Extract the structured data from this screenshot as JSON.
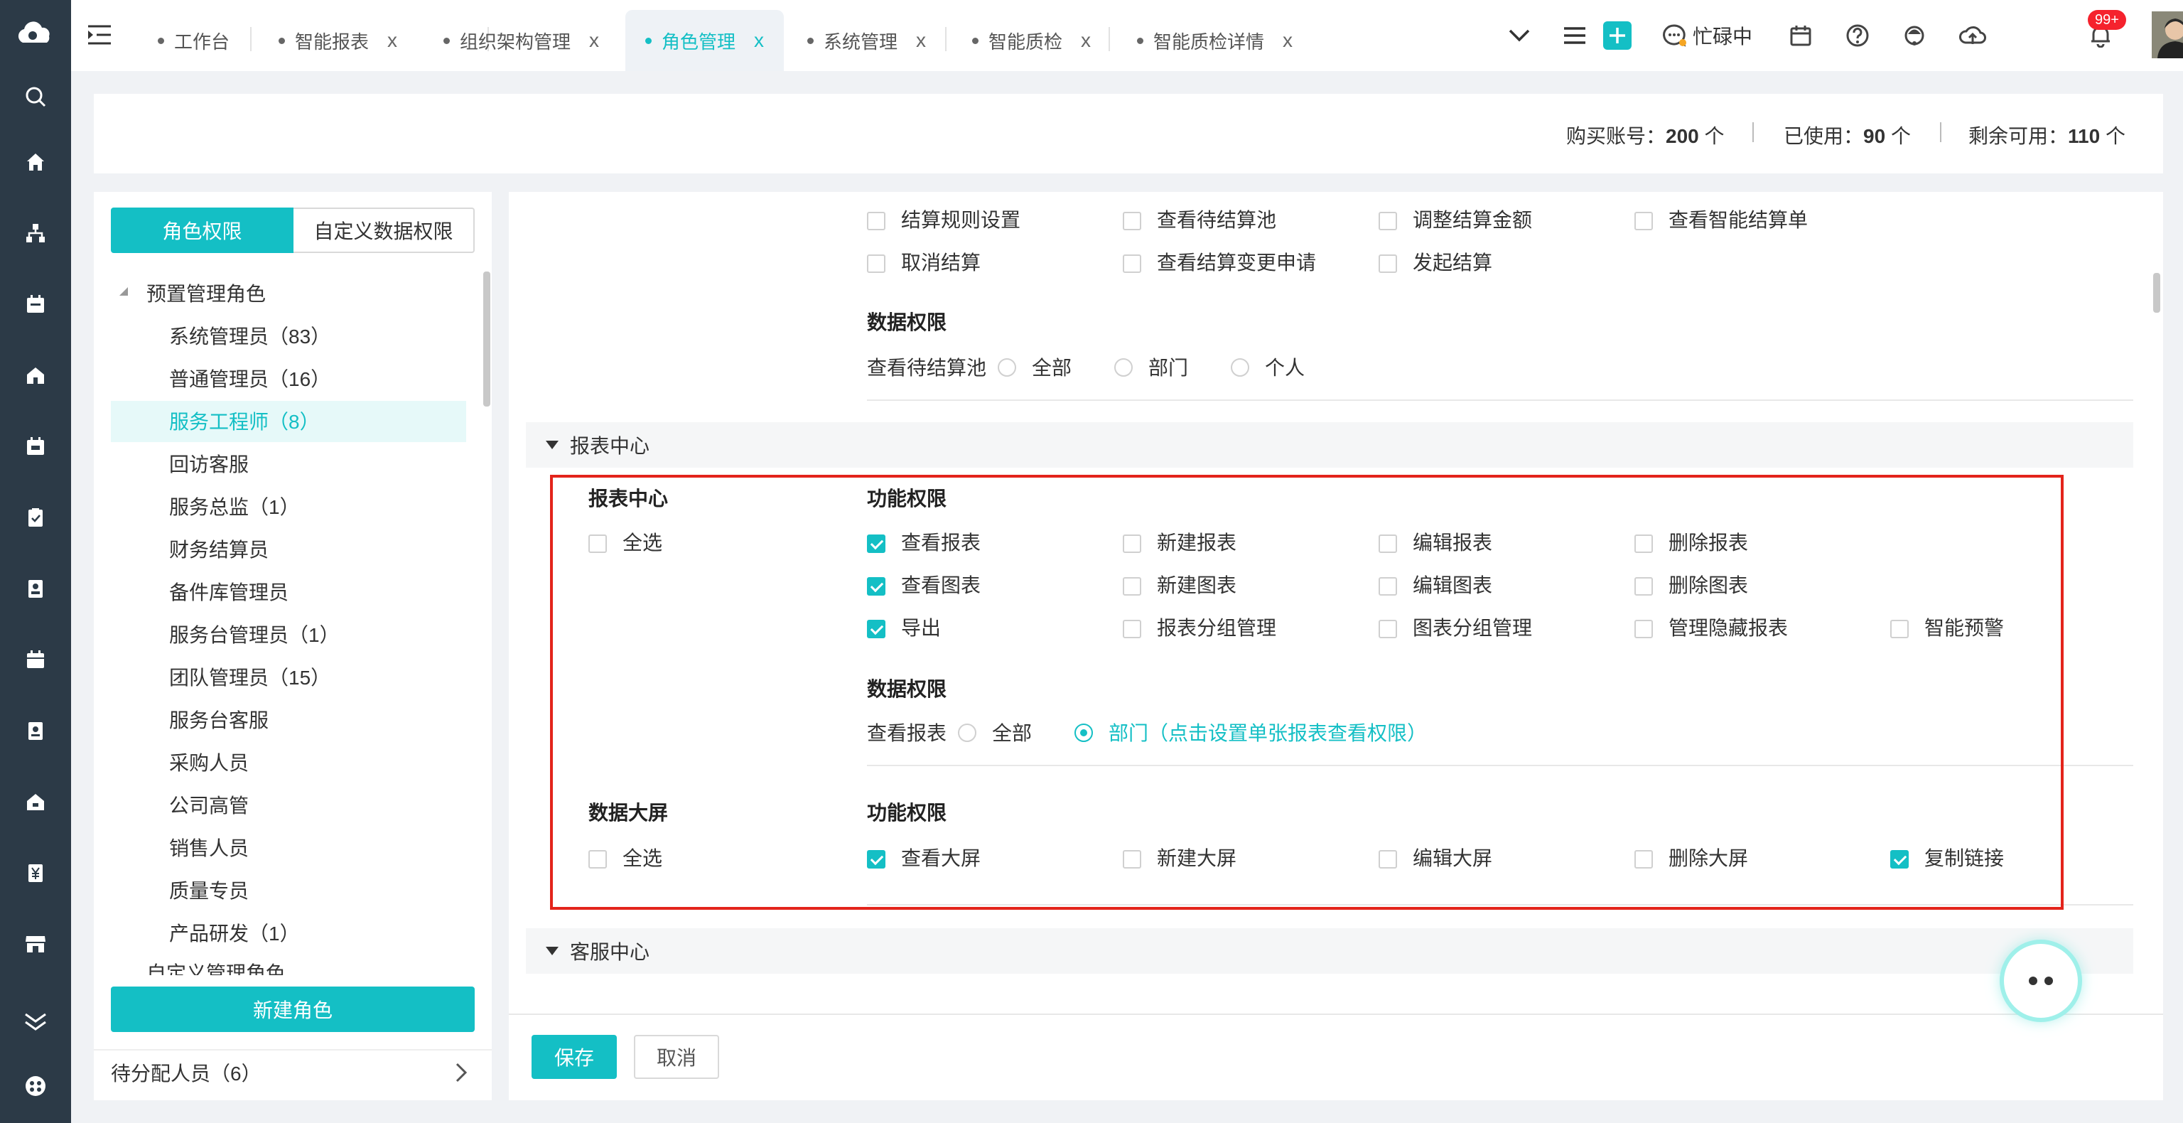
{
  "sidebar": {
    "icons": [
      "logo-icon",
      "search-icon",
      "home-icon",
      "org-icon",
      "calendar-icon",
      "house-icon",
      "calendar-alt-icon",
      "clipboard-icon",
      "contact-icon",
      "calendar-grid-icon",
      "id-card-icon",
      "house-alt-icon",
      "yen-icon",
      "store-icon",
      "chevron-double-down-icon",
      "settings-icon"
    ]
  },
  "topbar": {
    "tabs": [
      {
        "label": "工作台",
        "closable": false
      },
      {
        "label": "智能报表",
        "closable": true
      },
      {
        "label": "组织架构管理",
        "closable": true
      },
      {
        "label": "角色管理",
        "closable": true,
        "active": true
      },
      {
        "label": "系统管理",
        "closable": true
      },
      {
        "label": "智能质检",
        "closable": true
      },
      {
        "label": "智能质检详情",
        "closable": true
      }
    ],
    "close_glyph": "x",
    "status": "忙碌中",
    "badge": "99+"
  },
  "stats": {
    "purchased_label": "购买账号：",
    "purchased_value": "200",
    "unit": "个",
    "used_label": "已使用：",
    "used_value": "90",
    "remaining_label": "剩余可用：",
    "remaining_value": "110"
  },
  "left": {
    "tab_role": "角色权限",
    "tab_custom": "自定义数据权限",
    "group_preset": "预置管理角色",
    "roles": [
      "系统管理员（83）",
      "普通管理员（16）",
      "服务工程师（8）",
      "回访客服",
      "服务总监（1）",
      "财务结算员",
      "备件库管理员",
      "服务台管理员（1）",
      "团队管理员（15）",
      "服务台客服",
      "采购人员",
      "公司高管",
      "销售人员",
      "质量专员",
      "产品研发（1）"
    ],
    "group_custom": "自定义管理角色",
    "new_role": "新建角色",
    "pending": "待分配人员（6）"
  },
  "settlement": {
    "row1": [
      "结算规则设置",
      "查看待结算池",
      "调整结算金额",
      "查看智能结算单"
    ],
    "row2": [
      "取消结算",
      "查看结算变更申请",
      "发起结算"
    ],
    "data_title": "数据权限",
    "data_label": "查看待结算池",
    "data_options": [
      "全部",
      "部门",
      "个人"
    ]
  },
  "report_section": {
    "title": "报表中心",
    "group_title": "报表中心",
    "select_all": "全选",
    "func_title": "功能权限",
    "row1": [
      "查看报表",
      "新建报表",
      "编辑报表",
      "删除报表"
    ],
    "row2": [
      "查看图表",
      "新建图表",
      "编辑图表",
      "删除图表"
    ],
    "row3": [
      "导出",
      "报表分组管理",
      "图表分组管理",
      "管理隐藏报表",
      "智能预警"
    ],
    "data_title": "数据权限",
    "data_label": "查看报表",
    "data_opt_all": "全部",
    "data_opt_dept": "部门（点击设置单张报表查看权限）",
    "screen_title": "数据大屏",
    "screen_func_title": "功能权限",
    "screen_row": [
      "查看大屏",
      "新建大屏",
      "编辑大屏",
      "删除大屏",
      "复制链接"
    ]
  },
  "service_section": {
    "title": "客服中心"
  },
  "footer": {
    "save": "保存",
    "cancel": "取消"
  },
  "colors": {
    "accent": "#14bfc5",
    "sidebar": "#2c3a47",
    "highlight": "#e3241b"
  }
}
